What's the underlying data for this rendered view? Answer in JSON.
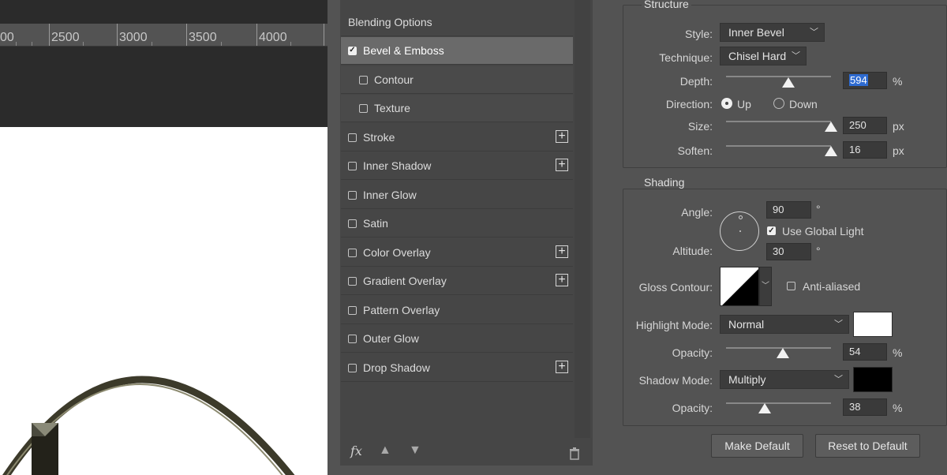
{
  "ruler": {
    "labels": [
      "00",
      "2500",
      "3000",
      "3500",
      "4000"
    ]
  },
  "styles": {
    "items": [
      {
        "label": "Blending Options",
        "checkbox": false,
        "plus": false
      },
      {
        "label": "Bevel & Emboss",
        "checkbox": true,
        "checked": true,
        "active": true,
        "plus": false
      },
      {
        "label": "Contour",
        "checkbox": true,
        "checked": false,
        "sub": true,
        "plus": false
      },
      {
        "label": "Texture",
        "checkbox": true,
        "checked": false,
        "sub": true,
        "plus": false
      },
      {
        "label": "Stroke",
        "checkbox": true,
        "checked": false,
        "plus": true
      },
      {
        "label": "Inner Shadow",
        "checkbox": true,
        "checked": false,
        "plus": true
      },
      {
        "label": "Inner Glow",
        "checkbox": true,
        "checked": false,
        "plus": false
      },
      {
        "label": "Satin",
        "checkbox": true,
        "checked": false,
        "plus": false
      },
      {
        "label": "Color Overlay",
        "checkbox": true,
        "checked": false,
        "plus": true
      },
      {
        "label": "Gradient Overlay",
        "checkbox": true,
        "checked": false,
        "plus": true
      },
      {
        "label": "Pattern Overlay",
        "checkbox": true,
        "checked": false,
        "plus": false
      },
      {
        "label": "Outer Glow",
        "checkbox": true,
        "checked": false,
        "plus": false
      },
      {
        "label": "Drop Shadow",
        "checkbox": true,
        "checked": false,
        "plus": true
      }
    ],
    "footer": {
      "fx": "fx",
      "up_icon": "arrow-up-icon",
      "down_icon": "arrow-down-icon",
      "trash_icon": "trash-icon"
    }
  },
  "structure": {
    "legend": "Structure",
    "style_label": "Style:",
    "style_value": "Inner Bevel",
    "technique_label": "Technique:",
    "technique_value": "Chisel Hard",
    "depth_label": "Depth:",
    "depth_value": "594",
    "depth_unit": "%",
    "direction_label": "Direction:",
    "dir_up": "Up",
    "dir_down": "Down",
    "direction_selected": "Up",
    "size_label": "Size:",
    "size_value": "250",
    "size_unit": "px",
    "soften_label": "Soften:",
    "soften_value": "16",
    "soften_unit": "px"
  },
  "shading": {
    "legend": "Shading",
    "angle_label": "Angle:",
    "angle_value": "90",
    "angle_unit": "°",
    "global_light_label": "Use Global Light",
    "global_light_checked": true,
    "altitude_label": "Altitude:",
    "altitude_value": "30",
    "altitude_unit": "°",
    "gloss_label": "Gloss Contour:",
    "anti_aliased_label": "Anti-aliased",
    "anti_aliased_checked": false,
    "highlight_label": "Highlight Mode:",
    "highlight_value": "Normal",
    "highlight_color": "#ffffff",
    "hl_opacity_label": "Opacity:",
    "hl_opacity_value": "54",
    "hl_opacity_unit": "%",
    "shadow_label": "Shadow Mode:",
    "shadow_value": "Multiply",
    "shadow_color": "#000000",
    "sh_opacity_label": "Opacity:",
    "sh_opacity_value": "38",
    "sh_opacity_unit": "%"
  },
  "buttons": {
    "make_default": "Make Default",
    "reset_default": "Reset to Default"
  },
  "colors": {
    "selection_highlight": "#2e6bd1",
    "logo_ring": "#3c3a2a"
  }
}
